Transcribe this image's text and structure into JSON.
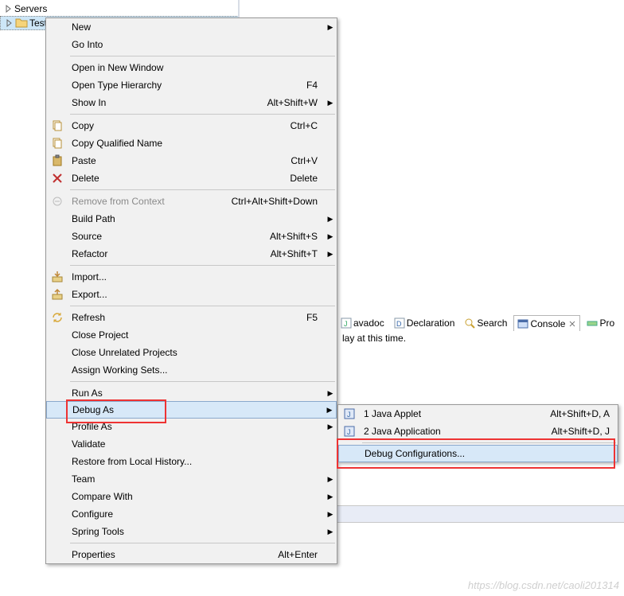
{
  "tree": {
    "item0": "Servers",
    "item1": "Test"
  },
  "menu": {
    "new": "New",
    "goInto": "Go Into",
    "openNewWindow": "Open in New Window",
    "openTypeHierarchy": "Open Type Hierarchy",
    "openTypeHierarchy_sc": "F4",
    "showIn": "Show In",
    "showIn_sc": "Alt+Shift+W",
    "copy": "Copy",
    "copy_sc": "Ctrl+C",
    "copyQualified": "Copy Qualified Name",
    "paste": "Paste",
    "paste_sc": "Ctrl+V",
    "delete": "Delete",
    "delete_sc": "Delete",
    "removeContext": "Remove from Context",
    "removeContext_sc": "Ctrl+Alt+Shift+Down",
    "buildPath": "Build Path",
    "source": "Source",
    "source_sc": "Alt+Shift+S",
    "refactor": "Refactor",
    "refactor_sc": "Alt+Shift+T",
    "import": "Import...",
    "export": "Export...",
    "refresh": "Refresh",
    "refresh_sc": "F5",
    "closeProject": "Close Project",
    "closeUnrelated": "Close Unrelated Projects",
    "assignWorkingSets": "Assign Working Sets...",
    "runAs": "Run As",
    "debugAs": "Debug As",
    "profileAs": "Profile As",
    "validate": "Validate",
    "restoreHistory": "Restore from Local History...",
    "team": "Team",
    "compareWith": "Compare With",
    "configure": "Configure",
    "springTools": "Spring Tools",
    "properties": "Properties",
    "properties_sc": "Alt+Enter"
  },
  "submenu": {
    "javaApplet": "1 Java Applet",
    "javaApplet_sc": "Alt+Shift+D, A",
    "javaApp": "2 Java Application",
    "javaApp_sc": "Alt+Shift+D, J",
    "debugConfig": "Debug Configurations..."
  },
  "tabs": {
    "javadoc": "avadoc",
    "declaration": "Declaration",
    "search": "Search",
    "console": "Console",
    "progress": "Pro"
  },
  "bgText": "lay at this time.",
  "watermark": "https://blog.csdn.net/caoli201314"
}
